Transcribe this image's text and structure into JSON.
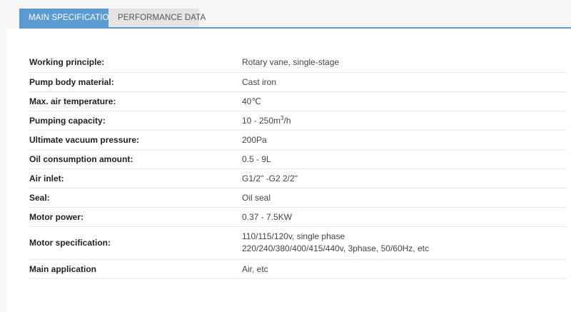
{
  "tabs": [
    {
      "label": "MAIN SPECIFICATION",
      "active": true
    },
    {
      "label": "PERFORMANCE DATA",
      "active": false
    }
  ],
  "colors": {
    "accent": "#5b9bd1",
    "inactive_tab": "#e4e4e4",
    "background": "#f6f6f6"
  },
  "specs": [
    {
      "label": "Working principle:",
      "value": "Rotary vane, single-stage"
    },
    {
      "label": "Pump body material:",
      "value": "Cast iron"
    },
    {
      "label": "Max. air temperature:",
      "value": "40℃"
    },
    {
      "label": "Pumping capacity:",
      "value": "10 - 250m",
      "value_sup": "3",
      "value_suffix": "/h"
    },
    {
      "label": "Ultimate vacuum pressure:",
      "value": "200Pa"
    },
    {
      "label": "Oil consumption amount:",
      "value": "0.5 - 9L"
    },
    {
      "label": "Air inlet:",
      "value": "G1/2\" -G2 2/2\""
    },
    {
      "label": "Seal:",
      "value": "Oil seal"
    },
    {
      "label": "Motor power:",
      "value": "0.37 - 7.5KW"
    },
    {
      "label": "Motor specification:",
      "value_lines": [
        "110/115/120v, single phase",
        "220/240/380/400/415/440v, 3phase, 50/60Hz, etc"
      ]
    },
    {
      "label": "Main application",
      "value": "Air, etc"
    }
  ]
}
